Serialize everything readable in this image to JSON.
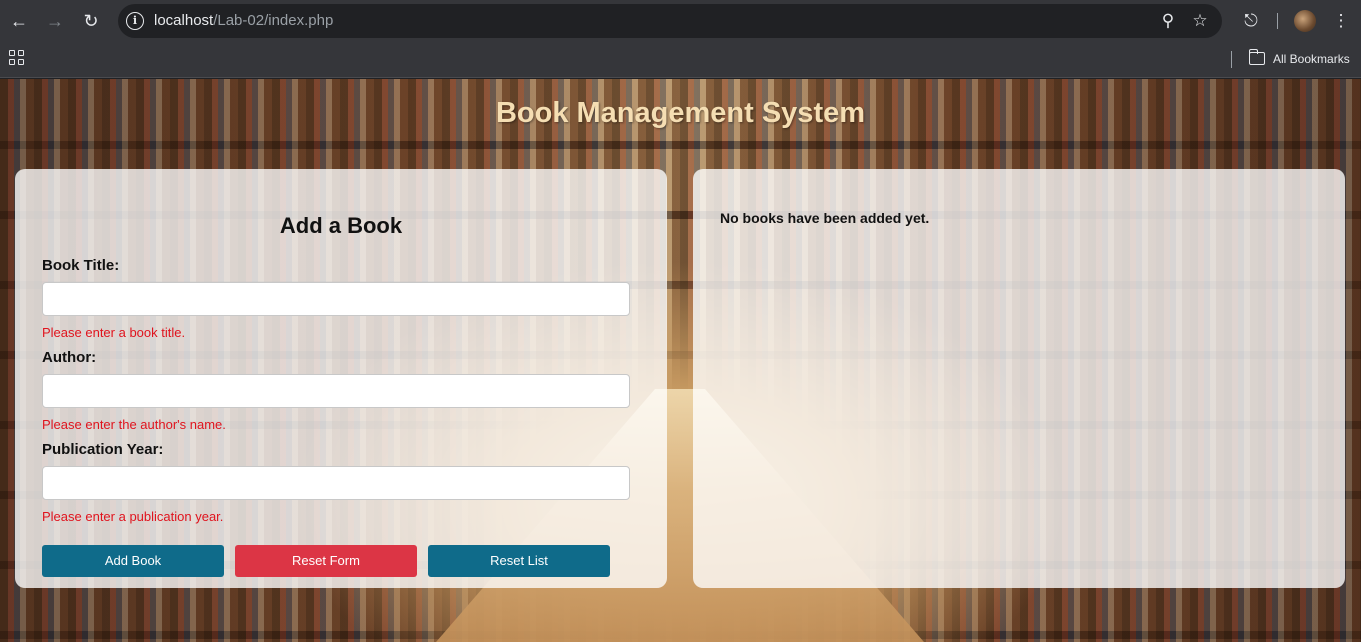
{
  "browser": {
    "url_host": "localhost",
    "url_path": "/Lab-02/index.php",
    "bookmarks_label": "All Bookmarks"
  },
  "page": {
    "title": "Book Management System"
  },
  "form": {
    "heading": "Add a Book",
    "fields": [
      {
        "label": "Book Title:",
        "value": "",
        "error": "Please enter a book title."
      },
      {
        "label": "Author:",
        "value": "",
        "error": "Please enter the author's name."
      },
      {
        "label": "Publication Year:",
        "value": "",
        "error": "Please enter a publication year."
      }
    ],
    "buttons": {
      "add": "Add Book",
      "reset_form": "Reset Form",
      "reset_list": "Reset List"
    }
  },
  "list": {
    "empty_message": "No books have been added yet."
  },
  "colors": {
    "title": "#f5deb3",
    "primary_button": "#0f6b8a",
    "danger_button": "#dc3545",
    "error_text": "#e0141e"
  }
}
